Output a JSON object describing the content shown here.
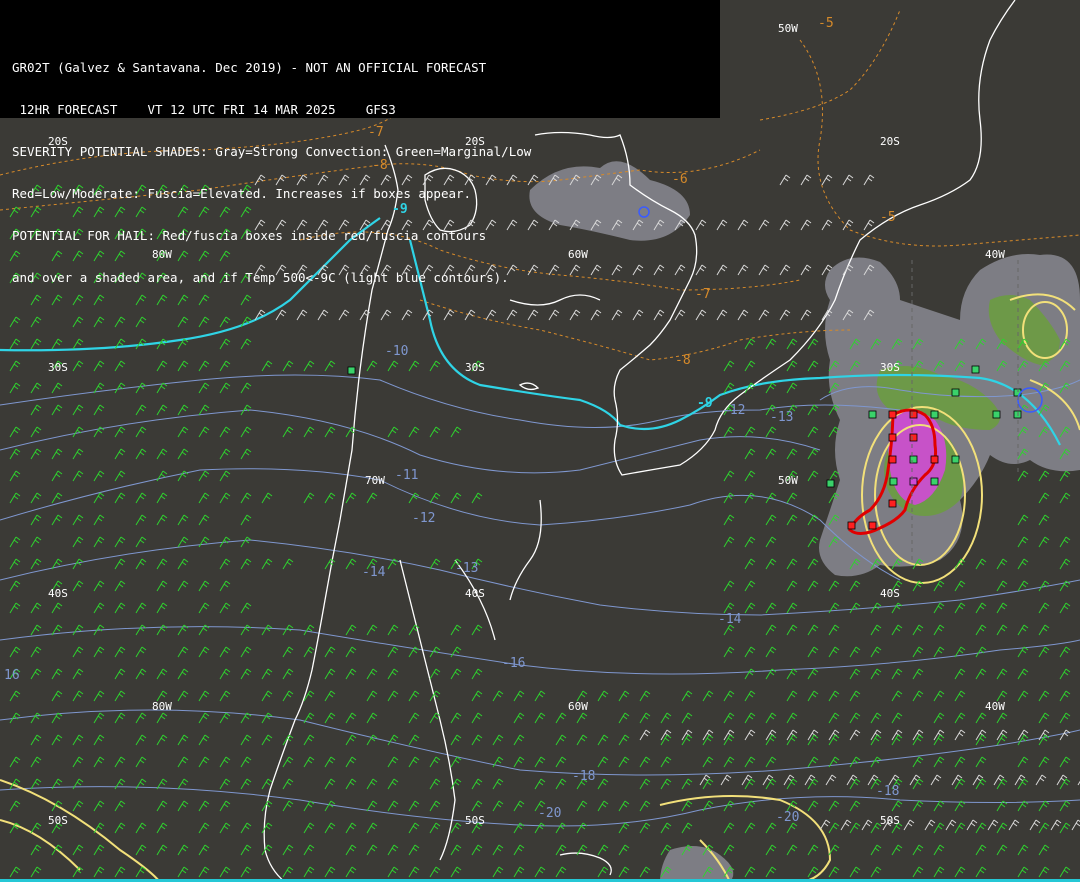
{
  "header": {
    "lines": [
      "GR02T (Galvez & Santavana. Dec 2019) - NOT AN OFFICIAL FORECAST",
      " 12HR FORECAST    VT 12 UTC FRI 14 MAR 2025    GFS3",
      "SEVERITY POTENTIAL SHADES: Gray=Strong Convection: Green=Marginal/Low",
      "Red=Low/Moderate: Fuscia=Elevated. Increases if boxes appear.",
      "POTENTIAL FOR HAIL: Red/fuscia boxes inside red/fuscia contours",
      "and over a shaded area, and if Temp 500<-9C (light blue contours)."
    ]
  },
  "grid_labels": {
    "lat_20s": "20S",
    "lat_30s": "30S",
    "lat_40s": "40S",
    "lat_50s": "50S",
    "lon_80w": "80W",
    "lon_70w": "70W",
    "lon_60w": "60W",
    "lon_50w": "50W",
    "lon_40w": "40W"
  },
  "contour_labels": {
    "orange": [
      "-5",
      "-7",
      "-8",
      "-6",
      "-5",
      "-7",
      "-8"
    ],
    "blue": [
      "-10",
      "-11",
      "-12",
      "-13",
      "-14",
      "-16",
      "-18",
      "-20",
      "-13",
      "-14",
      "-12",
      "-18",
      "-20",
      "16",
      "-12",
      "-16"
    ],
    "cyan": [
      "-9",
      "-9"
    ]
  },
  "colors": {
    "background": "#3b3a36",
    "coastline": "#ffffff",
    "temp_orange": "#d68a2a",
    "temp_blue": "#7f97cf",
    "temp_cyan": "#2fd4e6",
    "wind_green": "#2fd22f",
    "wind_white": "#d8d8d8",
    "shade_gray": "#8a8a92",
    "shade_green": "#6aa03a",
    "shade_fuchsia": "#d04ad6",
    "contour_yellow": "#f2e07a",
    "contour_red": "#e00000"
  }
}
